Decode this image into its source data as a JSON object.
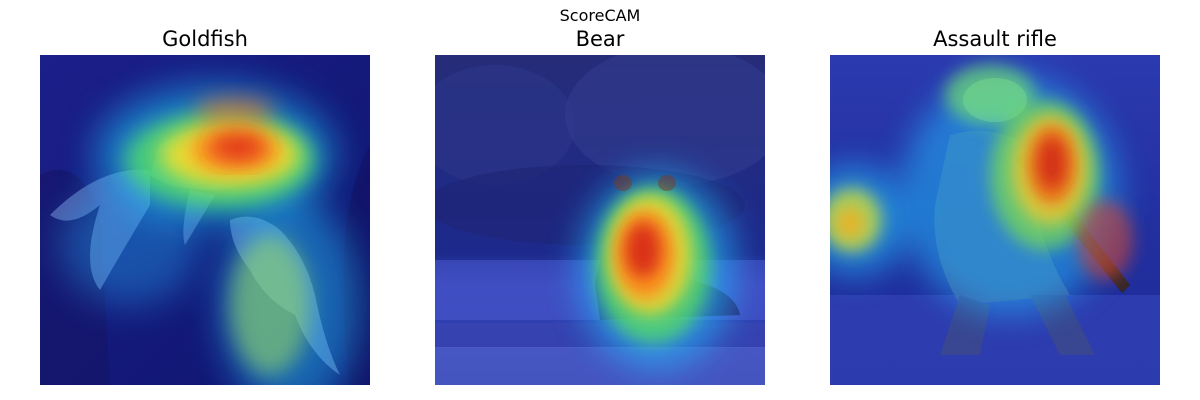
{
  "figure": {
    "suptitle": "ScoreCAM",
    "panels": [
      {
        "title": "Goldfish",
        "subject": "goldfish",
        "colormap": "jet"
      },
      {
        "title": "Bear",
        "subject": "bear",
        "colormap": "jet"
      },
      {
        "title": "Assault rifle",
        "subject": "soldier-with-rifle",
        "colormap": "jet"
      }
    ]
  }
}
